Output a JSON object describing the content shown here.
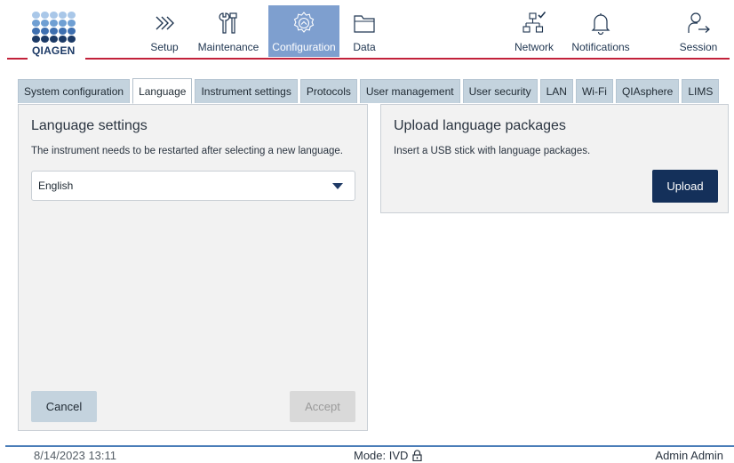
{
  "brand": {
    "logo_text": "QIAGEN",
    "dot_colors": [
      "#a9c7e8",
      "#a9c7e8",
      "#a9c7e8",
      "#a9c7e8",
      "#a9c7e8",
      "#6f9fd3",
      "#6f9fd3",
      "#6f9fd3",
      "#6f9fd3",
      "#6f9fd3",
      "#3e6fb0",
      "#3e6fb0",
      "#3e6fb0",
      "#3e6fb0",
      "#3e6fb0",
      "#1c3a66",
      "#1c3a66",
      "#1c3a66",
      "#1c3a66",
      "#1c3a66"
    ],
    "accent_red": "#c2213a",
    "active_nav_color": "#7e9fcf",
    "primary_button_color": "#14305a"
  },
  "nav": {
    "setup": {
      "label": "Setup",
      "icon": "chevrons-right-icon"
    },
    "maintenance": {
      "label": "Maintenance",
      "icon": "tools-icon"
    },
    "configuration": {
      "label": "Configuration",
      "icon": "gear-icon",
      "active": true
    },
    "data": {
      "label": "Data",
      "icon": "folder-icon"
    },
    "network": {
      "label": "Network",
      "icon": "network-connected-icon"
    },
    "notifications": {
      "label": "Notifications",
      "icon": "bell-icon"
    },
    "session": {
      "label": "Session",
      "icon": "user-logout-icon"
    }
  },
  "tabs": [
    {
      "label": "System configuration"
    },
    {
      "label": "Language",
      "active": true
    },
    {
      "label": "Instrument settings"
    },
    {
      "label": "Protocols"
    },
    {
      "label": "User management"
    },
    {
      "label": "User security"
    },
    {
      "label": "LAN"
    },
    {
      "label": "Wi-Fi"
    },
    {
      "label": "QIAsphere"
    },
    {
      "label": "LIMS"
    }
  ],
  "language_settings": {
    "title": "Language settings",
    "note": "The instrument needs to be restarted after selecting a new language.",
    "selected_language": "English",
    "cancel_label": "Cancel",
    "accept_label": "Accept"
  },
  "upload_packages": {
    "title": "Upload language packages",
    "note": "Insert a USB stick with language packages.",
    "upload_label": "Upload"
  },
  "footer": {
    "timestamp": "8/14/2023 13:11",
    "mode": "Mode: IVD",
    "mode_icon": "lock-icon",
    "user": "Admin Admin"
  }
}
